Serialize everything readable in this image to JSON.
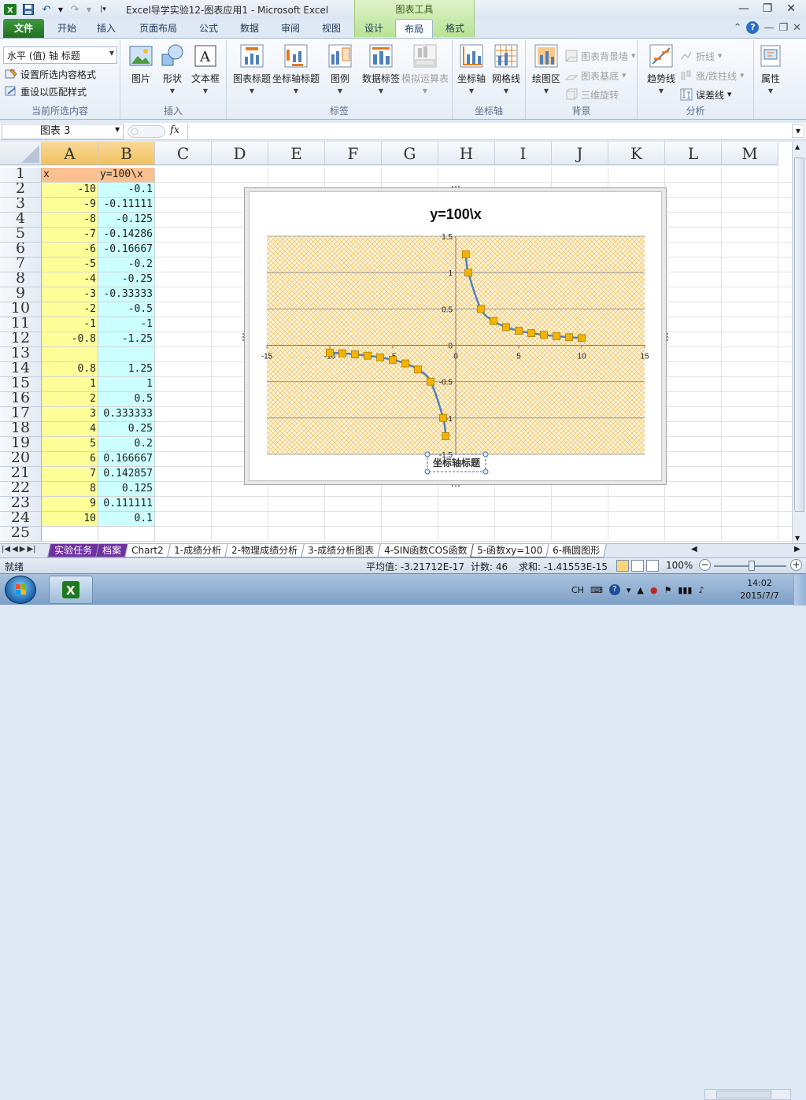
{
  "window": {
    "title": "Excel导学实验12-图表应用1 - Microsoft Excel",
    "context_tab_group": "图表工具"
  },
  "ribbon_tabs": [
    {
      "label": "文件",
      "kind": "file"
    },
    {
      "label": "开始"
    },
    {
      "label": "插入"
    },
    {
      "label": "页面布局"
    },
    {
      "label": "公式"
    },
    {
      "label": "数据"
    },
    {
      "label": "审阅"
    },
    {
      "label": "视图"
    },
    {
      "label": "设计"
    },
    {
      "label": "布局",
      "active": true
    },
    {
      "label": "格式"
    }
  ],
  "ribbon": {
    "current_selection": {
      "combo_value": "水平 (值) 轴 标题",
      "format_selection": "设置所选内容格式",
      "reset_style": "重设以匹配样式",
      "group_label": "当前所选内容"
    },
    "insert": {
      "picture": "图片",
      "shapes": "形状",
      "textbox": "文本框",
      "group_label": "插入"
    },
    "labels": {
      "chart_title": "图表标题",
      "axis_titles": "坐标轴标题",
      "legend": "图例",
      "data_labels": "数据标签",
      "data_table": "模拟运算表",
      "group_label": "标签"
    },
    "axes": {
      "axes": "坐标轴",
      "gridlines": "网格线",
      "group_label": "坐标轴"
    },
    "background": {
      "plot_area": "绘图区",
      "chart_wall": "图表背景墙",
      "chart_floor": "图表基底",
      "rotation_3d": "三维旋转",
      "group_label": "背景"
    },
    "analysis": {
      "trendline": "趋势线",
      "lines": "折线",
      "up_down_bars": "涨/跌柱线",
      "error_bars": "误差线",
      "group_label": "分析"
    },
    "properties": {
      "label": "属性"
    }
  },
  "formula_bar": {
    "name_box": "图表 3",
    "fx": "fx",
    "formula": ""
  },
  "columns": [
    "A",
    "B",
    "C",
    "D",
    "E",
    "F",
    "G",
    "H",
    "I",
    "J",
    "K",
    "L",
    "M"
  ],
  "rows": [
    {
      "n": "1",
      "a": "x",
      "b": "y=100\\x"
    },
    {
      "n": "2",
      "a": "-10",
      "b": "-0.1"
    },
    {
      "n": "3",
      "a": "-9",
      "b": "-0.11111"
    },
    {
      "n": "4",
      "a": "-8",
      "b": "-0.125"
    },
    {
      "n": "5",
      "a": "-7",
      "b": "-0.14286"
    },
    {
      "n": "6",
      "a": "-6",
      "b": "-0.16667"
    },
    {
      "n": "7",
      "a": "-5",
      "b": "-0.2"
    },
    {
      "n": "8",
      "a": "-4",
      "b": "-0.25"
    },
    {
      "n": "9",
      "a": "-3",
      "b": "-0.33333"
    },
    {
      "n": "10",
      "a": "-2",
      "b": "-0.5"
    },
    {
      "n": "11",
      "a": "-1",
      "b": "-1"
    },
    {
      "n": "12",
      "a": "-0.8",
      "b": "-1.25"
    },
    {
      "n": "13",
      "a": "",
      "b": ""
    },
    {
      "n": "14",
      "a": "0.8",
      "b": "1.25"
    },
    {
      "n": "15",
      "a": "1",
      "b": "1"
    },
    {
      "n": "16",
      "a": "2",
      "b": "0.5"
    },
    {
      "n": "17",
      "a": "3",
      "b": "0.333333"
    },
    {
      "n": "18",
      "a": "4",
      "b": "0.25"
    },
    {
      "n": "19",
      "a": "5",
      "b": "0.2"
    },
    {
      "n": "20",
      "a": "6",
      "b": "0.166667"
    },
    {
      "n": "21",
      "a": "7",
      "b": "0.142857"
    },
    {
      "n": "22",
      "a": "8",
      "b": "0.125"
    },
    {
      "n": "23",
      "a": "9",
      "b": "0.111111"
    },
    {
      "n": "24",
      "a": "10",
      "b": "0.1"
    },
    {
      "n": "25",
      "a": "",
      "b": ""
    }
  ],
  "chart_data": {
    "type": "scatter",
    "title": "y=100\\x",
    "xlabel": "坐标轴标题",
    "ylabel": "",
    "xlim": [
      -15,
      15
    ],
    "ylim": [
      -1.5,
      1.5
    ],
    "xticks": [
      "-15",
      "-10",
      "-5",
      "0",
      "5",
      "10",
      "15"
    ],
    "yticks": [
      "-1.5",
      "-1",
      "-0.5",
      "0",
      "0.5",
      "1",
      "1.5"
    ],
    "grid": "horizontal major gridlines",
    "legend": "none",
    "plot_area_fill": "orange dotted pattern",
    "line_color": "#4f81bd",
    "marker_color": "#f2b400",
    "series": [
      {
        "points": [
          [
            -10,
            -0.1
          ],
          [
            -9,
            -0.11111
          ],
          [
            -8,
            -0.125
          ],
          [
            -7,
            -0.14286
          ],
          [
            -6,
            -0.16667
          ],
          [
            -5,
            -0.2
          ],
          [
            -4,
            -0.25
          ],
          [
            -3,
            -0.33333
          ],
          [
            -2,
            -0.5
          ],
          [
            -1,
            -1
          ],
          [
            -0.8,
            -1.25
          ]
        ]
      },
      {
        "points": [
          [
            0.8,
            1.25
          ],
          [
            1,
            1
          ],
          [
            2,
            0.5
          ],
          [
            3,
            0.333333
          ],
          [
            4,
            0.25
          ],
          [
            5,
            0.2
          ],
          [
            6,
            0.166667
          ],
          [
            7,
            0.142857
          ],
          [
            8,
            0.125
          ],
          [
            9,
            0.111111
          ],
          [
            10,
            0.1
          ]
        ]
      }
    ]
  },
  "sheet_tabs": [
    {
      "label": "实验任务",
      "style": "purple"
    },
    {
      "label": "档案",
      "style": "purple"
    },
    {
      "label": "Chart2"
    },
    {
      "label": "1-成绩分析"
    },
    {
      "label": "2-物理成绩分析"
    },
    {
      "label": "3-成绩分析图表"
    },
    {
      "label": "4-SIN函数COS函数"
    },
    {
      "label": "5-函数xy=100",
      "active": true
    },
    {
      "label": "6-椭圆图形"
    }
  ],
  "status": {
    "ready": "就绪",
    "average": "平均值: -3.21712E-17",
    "count": "计数: 46",
    "sum": "求和: -1.41553E-15",
    "zoom": "100%",
    "zoom_level": 1.0
  },
  "taskbar": {
    "lang": "CH",
    "time": "14:02",
    "date": "2015/7/7"
  },
  "colors": {
    "excel_green": "#207020",
    "col_a_fill": "#ffff99",
    "col_b_fill": "#ccffff",
    "header_fill": "#fac090"
  }
}
